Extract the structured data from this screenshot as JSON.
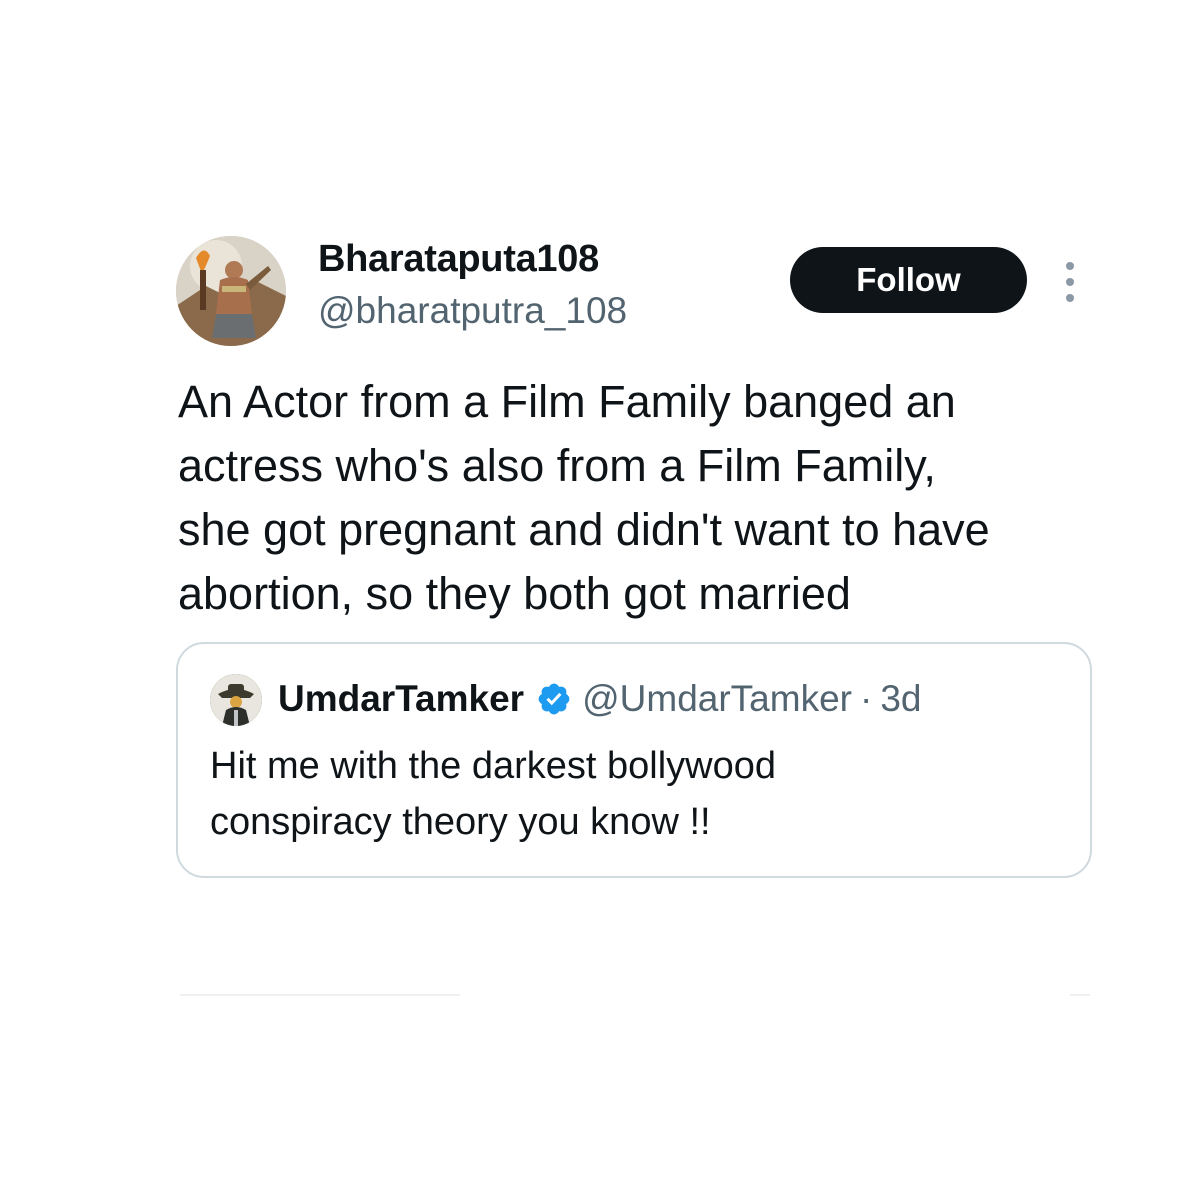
{
  "tweet": {
    "author": {
      "display_name": "Bharataputa108",
      "handle": "@bharatputra_108",
      "avatar_icon": "warrior-avatar"
    },
    "follow_label": "Follow",
    "more_icon": "more-vertical-icon",
    "text": "An Actor from a Film Family banged an\nactress who's also from a Film Family,\nshe got pregnant and didn't want to have\nabortion, so they both got married"
  },
  "quoted_tweet": {
    "author": {
      "display_name": "UmdarTamker",
      "handle": "@UmdarTamker",
      "verified_icon": "verified-badge-icon",
      "avatar_icon": "cowboy-avatar"
    },
    "separator": "·",
    "time": "3d",
    "text": "Hit me with the darkest bollywood\nconspiracy theory you know !!"
  },
  "colors": {
    "text_primary": "#0f1419",
    "text_secondary": "#536471",
    "follow_bg": "#0f1419",
    "verified_blue": "#1d9bf0",
    "border": "#cfd9de"
  }
}
